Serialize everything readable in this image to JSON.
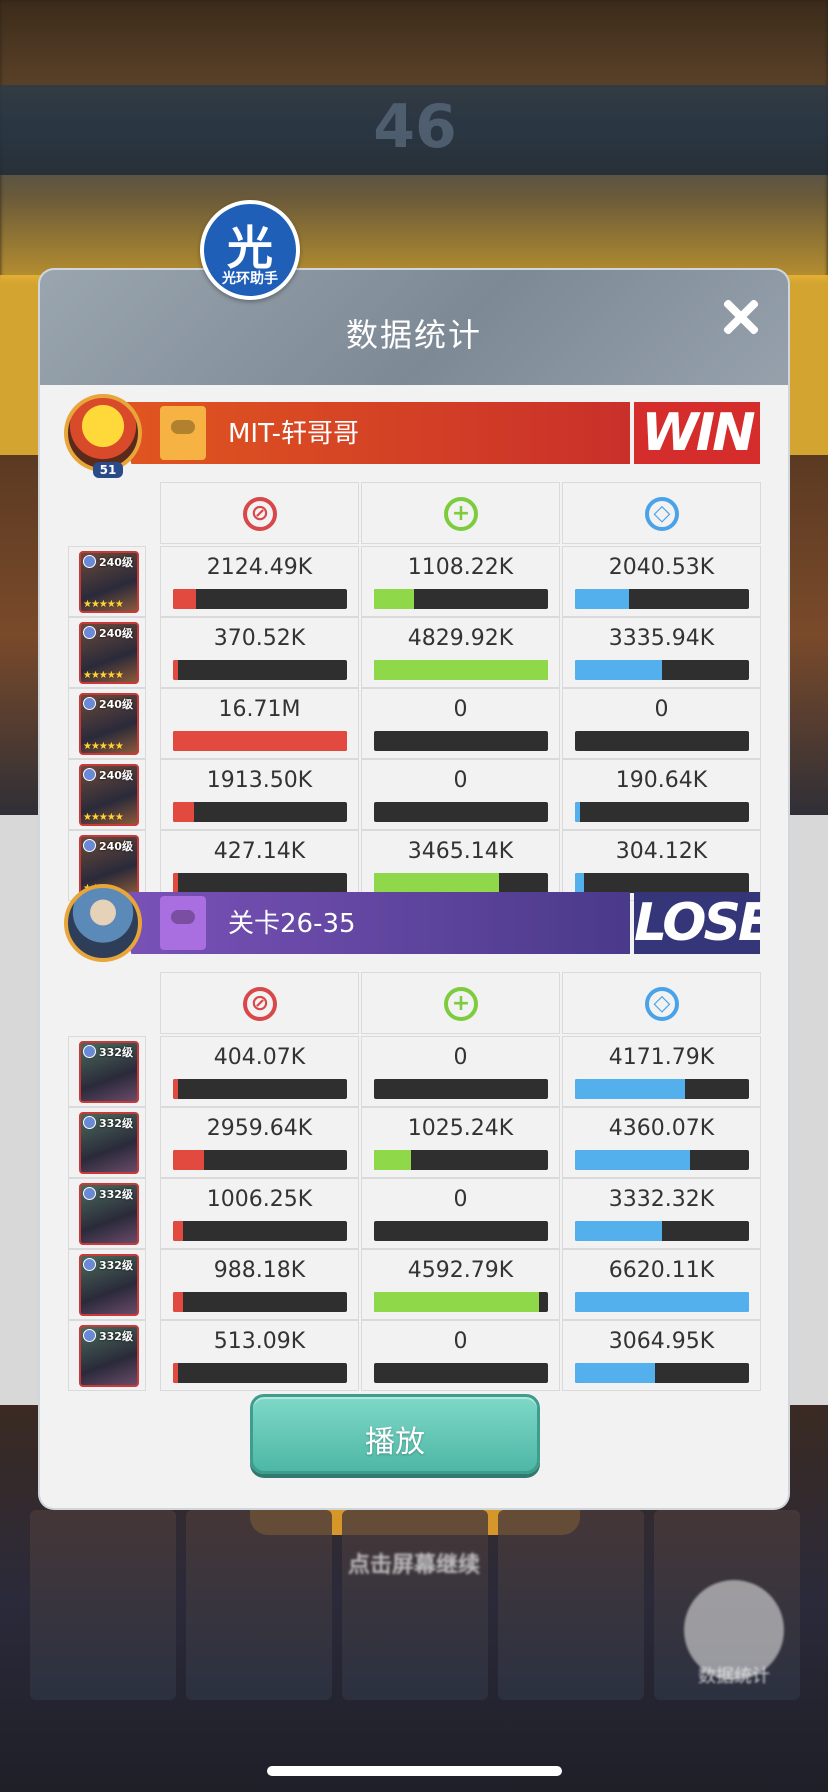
{
  "dialog": {
    "title": "数据统计",
    "play_label": "播放",
    "assist_badge": {
      "char": "光",
      "label": "光环助手"
    }
  },
  "background": {
    "score": "46",
    "hint": "点击屏幕继续",
    "stats_button_label": "数据统计"
  },
  "colors": {
    "damage": "#e2493f",
    "heal": "#8ed84a",
    "defense": "#54b0ec",
    "win": "#d42d2b",
    "lose": "#35357a",
    "play_button": "#4eb7a6"
  },
  "stat_icons": [
    "damage-icon",
    "heal-icon",
    "shield-icon"
  ],
  "teams": [
    {
      "name": "MIT-轩哥哥",
      "result": "WIN",
      "player_level": "51",
      "heroes": [
        {
          "level": "240级",
          "stars": "★★★★★",
          "damage": "2124.49K",
          "heal": "1108.22K",
          "defense": "2040.53K",
          "damage_pct": 0.13,
          "heal_pct": 0.23,
          "defense_pct": 0.31
        },
        {
          "level": "240级",
          "stars": "★★★★★",
          "damage": "370.52K",
          "heal": "4829.92K",
          "defense": "3335.94K",
          "damage_pct": 0.03,
          "heal_pct": 1.0,
          "defense_pct": 0.5
        },
        {
          "level": "240级",
          "stars": "★★★★★",
          "damage": "16.71M",
          "heal": "0",
          "defense": "0",
          "damage_pct": 1.0,
          "heal_pct": 0.0,
          "defense_pct": 0.0
        },
        {
          "level": "240级",
          "stars": "★★★★★",
          "damage": "1913.50K",
          "heal": "0",
          "defense": "190.64K",
          "damage_pct": 0.12,
          "heal_pct": 0.0,
          "defense_pct": 0.03
        },
        {
          "level": "240级",
          "stars": "★★",
          "damage": "427.14K",
          "heal": "3465.14K",
          "defense": "304.12K",
          "damage_pct": 0.03,
          "heal_pct": 0.72,
          "defense_pct": 0.05
        }
      ]
    },
    {
      "name": "关卡26-35",
      "result": "LOSE",
      "player_level": "",
      "heroes": [
        {
          "level": "332级",
          "stars": "",
          "damage": "404.07K",
          "heal": "0",
          "defense": "4171.79K",
          "damage_pct": 0.03,
          "heal_pct": 0.0,
          "defense_pct": 0.63
        },
        {
          "level": "332级",
          "stars": "",
          "damage": "2959.64K",
          "heal": "1025.24K",
          "defense": "4360.07K",
          "damage_pct": 0.18,
          "heal_pct": 0.21,
          "defense_pct": 0.66
        },
        {
          "level": "332级",
          "stars": "",
          "damage": "1006.25K",
          "heal": "0",
          "defense": "3332.32K",
          "damage_pct": 0.06,
          "heal_pct": 0.0,
          "defense_pct": 0.5
        },
        {
          "level": "332级",
          "stars": "",
          "damage": "988.18K",
          "heal": "4592.79K",
          "defense": "6620.11K",
          "damage_pct": 0.06,
          "heal_pct": 0.95,
          "defense_pct": 1.0
        },
        {
          "level": "332级",
          "stars": "",
          "damage": "513.09K",
          "heal": "0",
          "defense": "3064.95K",
          "damage_pct": 0.03,
          "heal_pct": 0.0,
          "defense_pct": 0.46
        }
      ]
    }
  ]
}
